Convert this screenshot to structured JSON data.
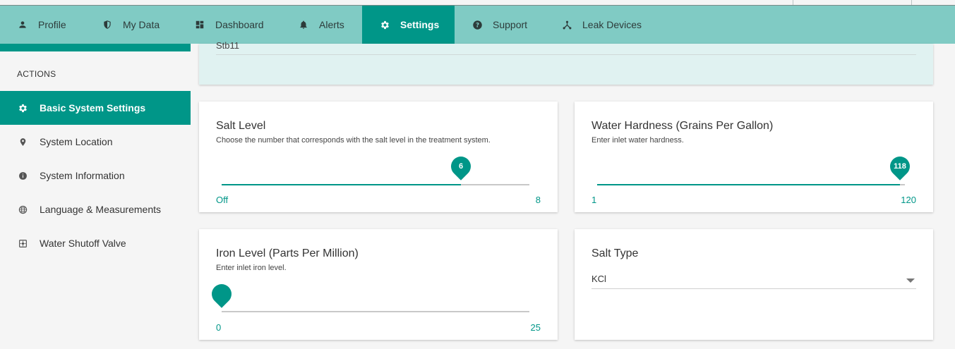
{
  "nav": {
    "items": [
      {
        "label": "Profile",
        "icon": "person-icon"
      },
      {
        "label": "My Data",
        "icon": "shield-icon"
      },
      {
        "label": "Dashboard",
        "icon": "dashboard-icon"
      },
      {
        "label": "Alerts",
        "icon": "bell-icon"
      },
      {
        "label": "Settings",
        "icon": "gear-icon",
        "active": true
      },
      {
        "label": "Support",
        "icon": "help-icon"
      },
      {
        "label": "Leak Devices",
        "icon": "hub-icon"
      }
    ]
  },
  "sidebar": {
    "heading": "ACTIONS",
    "items": [
      {
        "label": "Basic System Settings",
        "icon": "gear-icon",
        "active": true
      },
      {
        "label": "System Location",
        "icon": "location-pin-icon"
      },
      {
        "label": "System Information",
        "icon": "info-icon"
      },
      {
        "label": "Language & Measurements",
        "icon": "globe-icon"
      },
      {
        "label": "Water Shutoff Valve",
        "icon": "valve-icon"
      }
    ]
  },
  "top_field": {
    "value": "Stb11"
  },
  "cards": {
    "salt_level": {
      "title": "Salt Level",
      "desc": "Choose the number that corresponds with the salt level in the treatment system.",
      "value": "6",
      "min_label": "Off",
      "max_label": "8"
    },
    "water_hardness": {
      "title": "Water Hardness (Grains Per Gallon)",
      "desc": "Enter inlet water hardness.",
      "value": "118",
      "min_label": "1",
      "max_label": "120"
    },
    "iron_level": {
      "title": "Iron Level (Parts Per Million)",
      "desc": "Enter inlet iron level.",
      "value": "0",
      "min_label": "0",
      "max_label": "25"
    },
    "salt_type": {
      "title": "Salt Type",
      "selected": "KCl"
    }
  },
  "colors": {
    "accent": "#009688",
    "navbar": "#80cbc4",
    "light_teal": "#e0f2f1"
  }
}
